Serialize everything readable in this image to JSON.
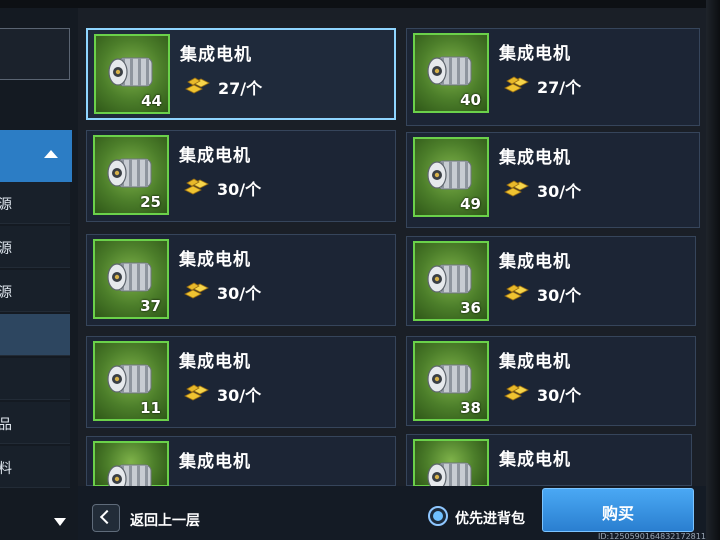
{
  "sidebar": {
    "items": [
      {
        "label": "源"
      },
      {
        "label": "源"
      },
      {
        "label": "源"
      },
      {
        "label": ""
      },
      {
        "label": ""
      },
      {
        "label": "品"
      },
      {
        "label": "料"
      }
    ]
  },
  "items": [
    {
      "name": "集成电机",
      "count": "44",
      "price": "27/个"
    },
    {
      "name": "集成电机",
      "count": "40",
      "price": "27/个"
    },
    {
      "name": "集成电机",
      "count": "25",
      "price": "30/个"
    },
    {
      "name": "集成电机",
      "count": "49",
      "price": "30/个"
    },
    {
      "name": "集成电机",
      "count": "37",
      "price": "30/个"
    },
    {
      "name": "集成电机",
      "count": "36",
      "price": "30/个"
    },
    {
      "name": "集成电机",
      "count": "11",
      "price": "30/个"
    },
    {
      "name": "集成电机",
      "count": "38",
      "price": "30/个"
    },
    {
      "name": "集成电机",
      "count": "",
      "price": ""
    },
    {
      "name": "集成电机",
      "count": "",
      "price": ""
    }
  ],
  "footer": {
    "back_label": "返回上一层",
    "priority_label": "优先进背包",
    "buy_label": "购买",
    "id_text": "ID:1250590164832172811"
  },
  "colors": {
    "accent": "#2c7dc5",
    "thumb_border": "#6bd14a",
    "selected_border": "#8fd5ff",
    "buy_button": "#3a94e4"
  },
  "icons": [
    "chevron-up-icon",
    "chevron-down-icon",
    "motor-icon",
    "gold-icon",
    "back-chevron-icon"
  ]
}
